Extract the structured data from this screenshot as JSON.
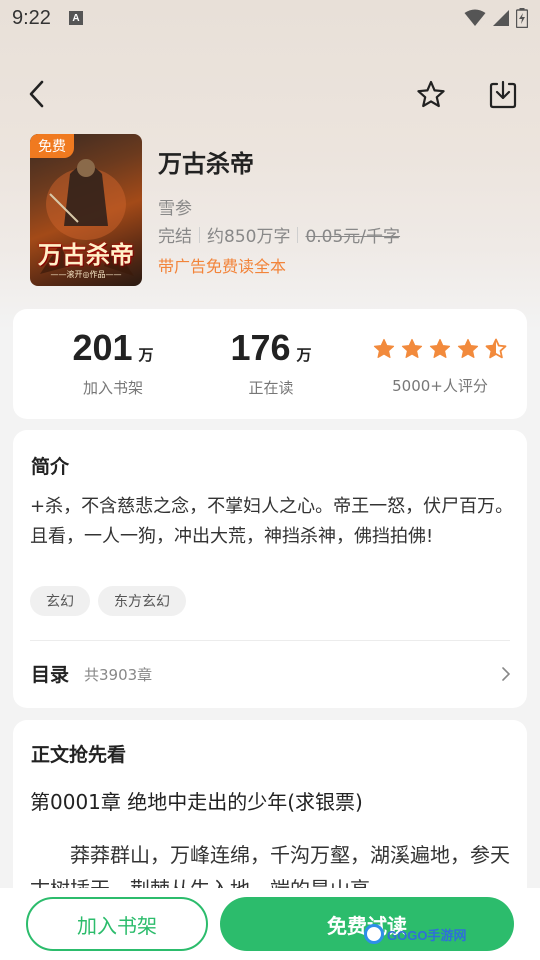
{
  "status_bar": {
    "time": "9:22",
    "notification_icon_letter": "A",
    "icons": [
      "wifi-icon",
      "signal-icon",
      "battery-icon"
    ]
  },
  "nav": {
    "icons": [
      "back-arrow-icon",
      "star-outline-icon",
      "download-icon"
    ]
  },
  "book": {
    "free_badge": "免费",
    "cover_title": "万古杀帝",
    "cover_subtitle": "——滚开◎作品——",
    "title": "万古杀帝",
    "author": "雪参",
    "status": "完结",
    "word_count": "约850万字",
    "price": "0.05元/千字",
    "ad_notice": "带广告免费读全本"
  },
  "stats": {
    "shelf": {
      "number": "201",
      "unit": "万",
      "label": "加入书架"
    },
    "reading": {
      "number": "176",
      "unit": "万",
      "label": "正在读"
    },
    "rating": {
      "stars": 4.5,
      "label": "5000+人评分",
      "star_color": "#f28a3c"
    }
  },
  "intro": {
    "heading": "简介",
    "text": "+杀，不含慈悲之念，不掌妇人之心。帝王一怒，伏尸百万。且看，一人一狗，冲出大荒，神挡杀神，佛挡拍佛!",
    "tags": [
      "玄幻",
      "东方玄幻"
    ],
    "toc_label": "目录",
    "toc_count": "共3903章"
  },
  "preview": {
    "heading": "正文抢先看",
    "chapter_title": "第0001章 绝地中走出的少年(求银票)",
    "text": "莽莽群山，万峰连绵，千沟万壑，湖溪遍地，参天古树插天，荆棘从生入地，端的是山高"
  },
  "actions": {
    "add_shelf": "加入书架",
    "free_read": "免费试读",
    "accent_color": "#2cbc6c"
  },
  "watermark": {
    "text": "GOGO手游网"
  }
}
